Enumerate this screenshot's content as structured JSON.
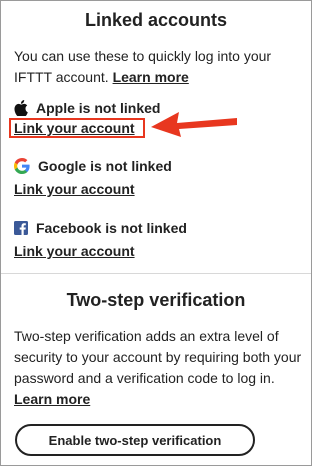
{
  "linked_accounts": {
    "title": "Linked accounts",
    "description": "You can use these to quickly log into your IFTTT account.",
    "learn_more": "Learn more",
    "providers": [
      {
        "icon": "apple-icon",
        "status": "Apple is not linked",
        "link": "Link your account"
      },
      {
        "icon": "google-icon",
        "status": "Google is not linked",
        "link": "Link your account"
      },
      {
        "icon": "facebook-icon",
        "status": "Facebook is not linked",
        "link": "Link your account"
      }
    ]
  },
  "two_step": {
    "title": "Two-step verification",
    "description": "Two-step verification adds an extra level of security to your account by requiring both your password and a verification code to log in.",
    "learn_more": "Learn more",
    "button": "Enable two-step verification"
  },
  "colors": {
    "annotation": "#e8371f",
    "facebook": "#3b5998"
  }
}
